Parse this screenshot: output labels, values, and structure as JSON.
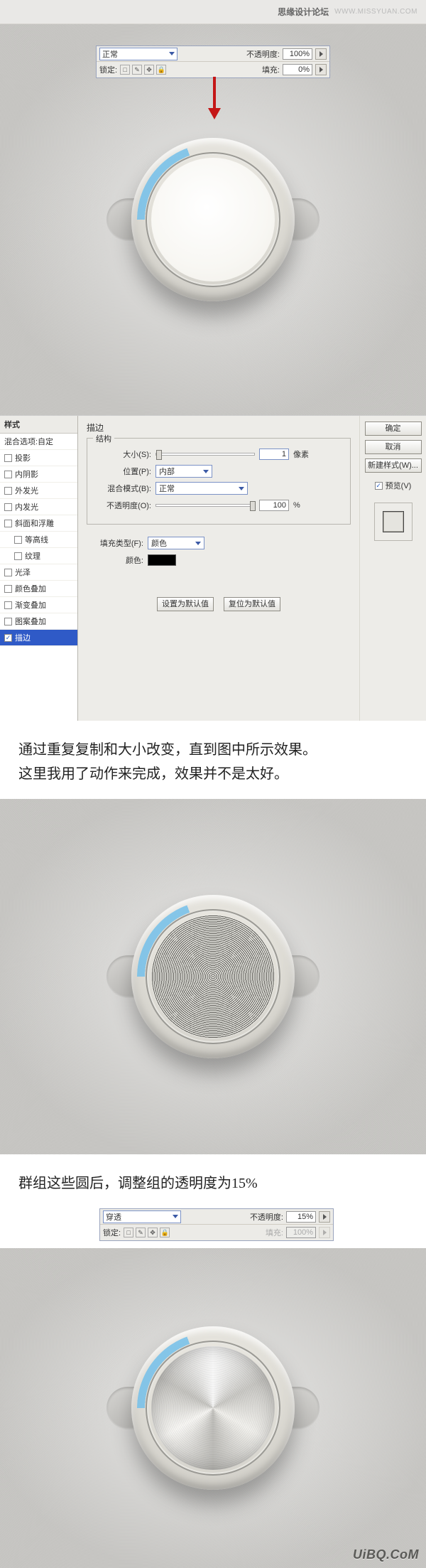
{
  "header": {
    "logo": "思缘设计论坛",
    "url": "WWW.MISSYUAN.COM"
  },
  "layerPanel": {
    "blendLabel": "正常",
    "blendLabel2": "穿透",
    "opacityLabel": "不透明度:",
    "opacityValue": "100%",
    "opacityValue2": "15%",
    "lockLabel": "锁定:",
    "fillLabel": "填充:",
    "fillValue": "0%",
    "fillValue2": "100%"
  },
  "dialog": {
    "styleHead": "样式",
    "blendingOptions": "混合选项:自定",
    "items": {
      "dropShadow": "投影",
      "innerShadow": "内阴影",
      "outerGlow": "外发光",
      "innerGlow": "内发光",
      "bevel": "斜面和浮雕",
      "contour": "等高线",
      "texture": "纹理",
      "satin": "光泽",
      "colorOverlay": "颜色叠加",
      "gradientOverlay": "渐变叠加",
      "patternOverlay": "图案叠加",
      "stroke": "描边"
    },
    "panelTitle": "描边",
    "groupStructure": "结构",
    "sizeLabel": "大小(S):",
    "sizeValue": "1",
    "sizeUnit": "像素",
    "positionLabel": "位置(P):",
    "positionValue": "内部",
    "blendModeLabel": "混合模式(B):",
    "blendModeValue": "正常",
    "opacityLabel": "不透明度(O):",
    "opacityValue": "100",
    "opacityUnit": "%",
    "fillTypeLabel": "填充类型(F):",
    "fillTypeValue": "颜色",
    "colorLabel": "颜色:",
    "setDefault": "设置为默认值",
    "resetDefault": "复位为默认值",
    "ok": "确定",
    "cancel": "取消",
    "newStyle": "新建样式(W)...",
    "previewChk": "预览(V)"
  },
  "text1a": "通过重复复制和大小改变，直到图中所示效果。",
  "text1b": "这里我用了动作来完成，效果并不是太好。",
  "text2": "群组这些圆后，调整组的透明度为15%",
  "watermark": "UiBQ.CoM"
}
